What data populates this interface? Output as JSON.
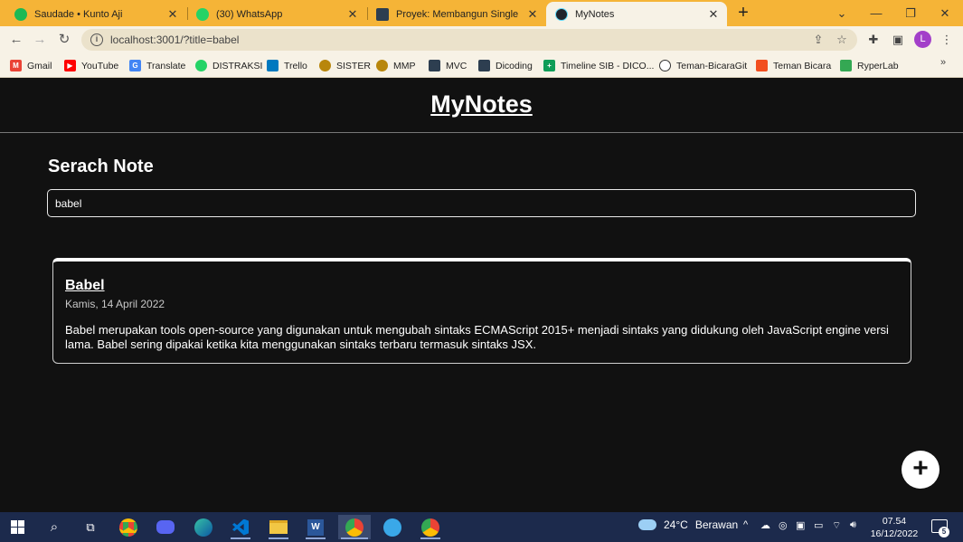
{
  "browser": {
    "tabs": [
      {
        "title": "Saudade • Kunto Aji",
        "icon": "spotify-icon",
        "color": "#1db954"
      },
      {
        "title": "(30) WhatsApp",
        "icon": "whatsapp-icon",
        "color": "#25d366"
      },
      {
        "title": "Proyek: Membangun Single Page",
        "icon": "dicoding-icon",
        "color": "#2d3e50"
      },
      {
        "title": "MyNotes",
        "icon": "react-icon",
        "color": "#61dafb"
      }
    ],
    "new_tab": "+",
    "address": {
      "url": "localhost:3001/?title=babel"
    },
    "profile_initial": "L",
    "bookmarks": [
      {
        "label": "Gmail",
        "icon": "gmail-icon",
        "color": "#ea4335"
      },
      {
        "label": "YouTube",
        "icon": "youtube-icon",
        "color": "#ff0000"
      },
      {
        "label": "Translate",
        "icon": "translate-icon",
        "color": "#4285f4"
      },
      {
        "label": "DISTRAKSI",
        "icon": "whatsapp-icon",
        "color": "#25d366"
      },
      {
        "label": "Trello",
        "icon": "trello-icon",
        "color": "#0079bf"
      },
      {
        "label": "SISTER",
        "icon": "sister-icon",
        "color": "#b8860b"
      },
      {
        "label": "MMP",
        "icon": "mmp-icon",
        "color": "#b8860b"
      },
      {
        "label": "MVC",
        "icon": "dicoding-icon",
        "color": "#2d3e50"
      },
      {
        "label": "Dicoding",
        "icon": "dicoding-icon",
        "color": "#2d3e50"
      },
      {
        "label": "Timeline SIB - DICO...",
        "icon": "sheets-icon",
        "color": "#0f9d58"
      },
      {
        "label": "Teman-BicaraGit",
        "icon": "github-icon",
        "color": "#333333"
      },
      {
        "label": "Teman Bicara",
        "icon": "figma-icon",
        "color": "#f24e1e"
      },
      {
        "label": "RyperLab",
        "icon": "drive-icon",
        "color": "#34a853"
      }
    ],
    "bookmarks_more": "»"
  },
  "app": {
    "brand": "MyNotes",
    "search": {
      "heading": "Serach Note",
      "value": "babel"
    },
    "notes": [
      {
        "title": "Babel",
        "date": "Kamis, 14 April 2022",
        "body": "Babel merupakan tools open-source yang digunakan untuk mengubah sintaks ECMAScript 2015+ menjadi sintaks yang didukung oleh JavaScript engine versi lama. Babel sering dipakai ketika kita menggunakan sintaks terbaru termasuk sintaks JSX."
      }
    ],
    "add_button": "+"
  },
  "taskbar": {
    "weather": {
      "temp": "24°C",
      "condition": "Berawan"
    },
    "time": "07.54",
    "date": "16/12/2022",
    "notifications": "5"
  }
}
